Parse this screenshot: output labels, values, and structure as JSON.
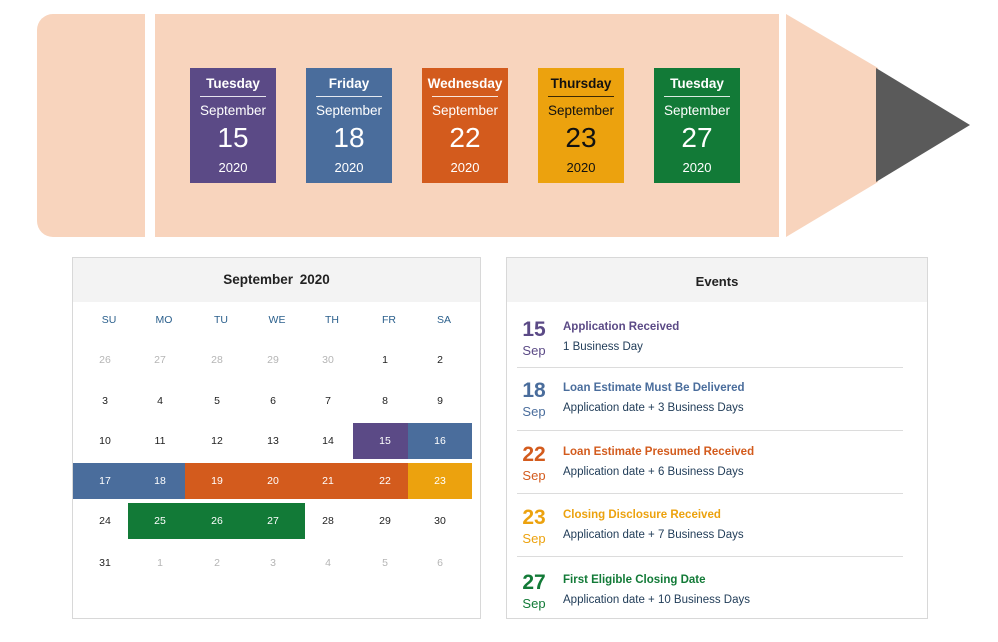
{
  "timeline": {
    "cards": [
      {
        "weekday": "Tuesday",
        "month": "September",
        "day": "15",
        "year": "2020",
        "color": "#5b4a86"
      },
      {
        "weekday": "Friday",
        "month": "September",
        "day": "18",
        "year": "2020",
        "color": "#4a6d9c"
      },
      {
        "weekday": "Wednesday",
        "month": "September",
        "day": "22",
        "year": "2020",
        "color": "#d35b1d"
      },
      {
        "weekday": "Thursday",
        "month": "September",
        "day": "23",
        "year": "2020",
        "color": "#eca20e"
      },
      {
        "weekday": "Tuesday",
        "month": "September",
        "day": "27",
        "year": "2020",
        "color": "#127a37"
      }
    ],
    "colors": {
      "pencil_body": "#f8d4bd",
      "pencil_lead": "#5a5a5a"
    }
  },
  "calendar": {
    "title": "September  2020",
    "weekdays": [
      "SU",
      "MO",
      "TU",
      "WE",
      "TH",
      "FR",
      "SA"
    ],
    "weeks": [
      [
        {
          "d": "26",
          "o": true
        },
        {
          "d": "27",
          "o": true
        },
        {
          "d": "28",
          "o": true
        },
        {
          "d": "29",
          "o": true
        },
        {
          "d": "30",
          "o": true
        },
        {
          "d": "1"
        },
        {
          "d": "2"
        }
      ],
      [
        {
          "d": "3"
        },
        {
          "d": "4"
        },
        {
          "d": "5"
        },
        {
          "d": "6"
        },
        {
          "d": "7"
        },
        {
          "d": "8"
        },
        {
          "d": "9"
        }
      ],
      [
        {
          "d": "10"
        },
        {
          "d": "11"
        },
        {
          "d": "12"
        },
        {
          "d": "13"
        },
        {
          "d": "14"
        },
        {
          "d": "15",
          "h": "#5b4a86"
        },
        {
          "d": "16",
          "h": "#4a6d9c"
        }
      ],
      [
        {
          "d": "17",
          "h": "#4a6d9c"
        },
        {
          "d": "18",
          "h": "#4a6d9c"
        },
        {
          "d": "19",
          "h": "#d35b1d"
        },
        {
          "d": "20",
          "h": "#d35b1d"
        },
        {
          "d": "21",
          "h": "#d35b1d"
        },
        {
          "d": "22",
          "h": "#d35b1d"
        },
        {
          "d": "23",
          "h": "#eca20e"
        }
      ],
      [
        {
          "d": "24"
        },
        {
          "d": "25",
          "h": "#127a37"
        },
        {
          "d": "26",
          "h": "#127a37"
        },
        {
          "d": "27",
          "h": "#127a37"
        },
        {
          "d": "28"
        },
        {
          "d": "29"
        },
        {
          "d": "30"
        }
      ],
      [
        {
          "d": "31"
        },
        {
          "d": "1",
          "o": true
        },
        {
          "d": "2",
          "o": true
        },
        {
          "d": "3",
          "o": true
        },
        {
          "d": "4",
          "o": true
        },
        {
          "d": "5",
          "o": true
        },
        {
          "d": "6",
          "o": true
        }
      ]
    ]
  },
  "events": {
    "title": "Events",
    "items": [
      {
        "day": "15",
        "month": "Sep",
        "name": "Application Received",
        "desc": "1 Business Day",
        "color": "#5b4a86"
      },
      {
        "day": "18",
        "month": "Sep",
        "name": "Loan Estimate Must Be Delivered",
        "desc": "Application date + 3 Business Days",
        "color": "#4a6d9c"
      },
      {
        "day": "22",
        "month": "Sep",
        "name": "Loan Estimate Presumed Received",
        "desc": "Application date + 6 Business Days",
        "color": "#d35b1d"
      },
      {
        "day": "23",
        "month": "Sep",
        "name": "Closing Disclosure Received",
        "desc": "Application date + 7 Business Days",
        "color": "#eca20e"
      },
      {
        "day": "27",
        "month": "Sep",
        "name": "First Eligible Closing Date",
        "desc": "Application date + 10 Business Days",
        "color": "#127a37"
      }
    ]
  }
}
